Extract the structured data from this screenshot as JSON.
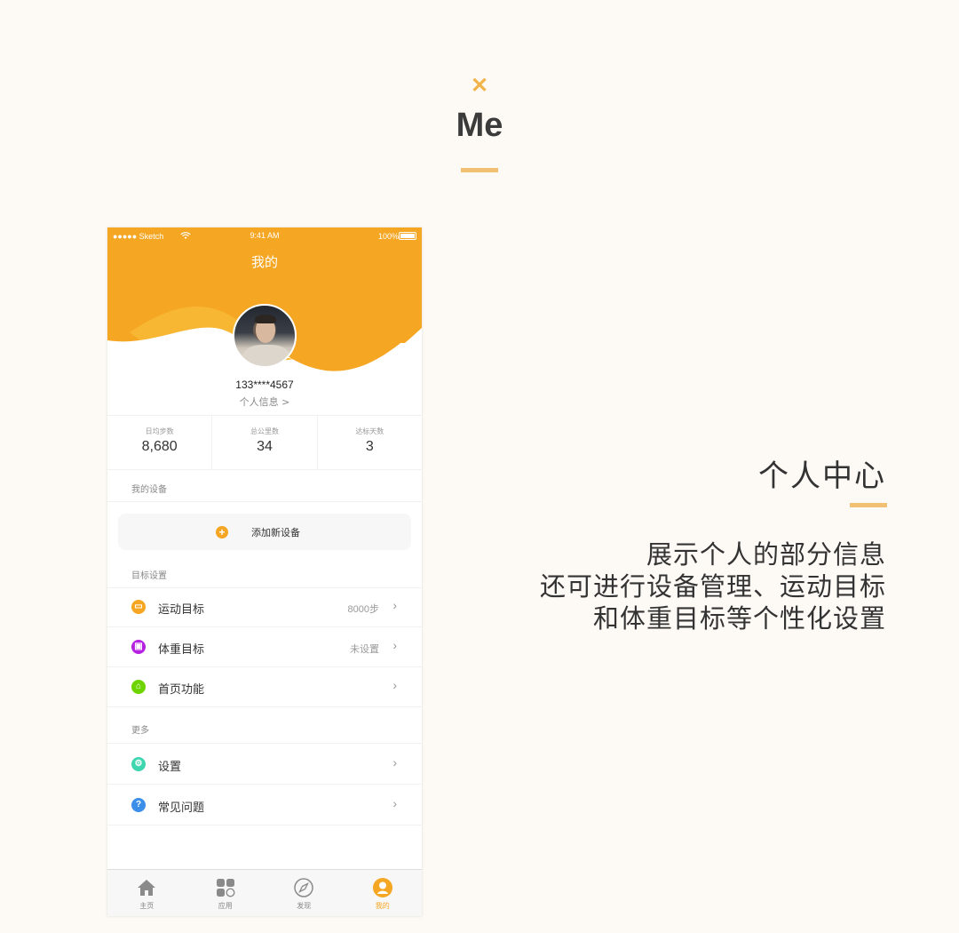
{
  "header": {
    "icon": "close-x-icon",
    "title": "Me"
  },
  "side": {
    "title": "个人中心",
    "desc": [
      "展示个人的部分信息",
      "还可进行设备管理、运动目标",
      "和体重目标等个性化设置"
    ]
  },
  "colors": {
    "accent": "#f5a623",
    "bar": "#f2c073",
    "background": "#fdfaf6"
  },
  "phone": {
    "status": {
      "carrier": "●●●●● Sketch",
      "time": "9:41 AM",
      "battery": "100%"
    },
    "nav_title": "我的",
    "profile": {
      "phone_number": "133****4567",
      "link": "个人信息 >"
    },
    "stats": [
      {
        "label": "日均步数",
        "value": "8,680"
      },
      {
        "label": "总公里数",
        "value": "34"
      },
      {
        "label": "达标天数",
        "value": "3"
      }
    ],
    "devices": {
      "section": "我的设备",
      "add_label": "添加新设备"
    },
    "goals": {
      "section": "目标设置",
      "items": [
        {
          "label": "运动目标",
          "value": "8000步",
          "icon": "sport-goal-icon",
          "color": "#f5a623"
        },
        {
          "label": "体重目标",
          "value": "未设置",
          "icon": "weight-goal-icon",
          "color": "#b620e0"
        },
        {
          "label": "首页功能",
          "value": "",
          "icon": "home-feature-icon",
          "color": "#6dd400"
        }
      ]
    },
    "more": {
      "section": "更多",
      "items": [
        {
          "label": "设置",
          "icon": "settings-icon",
          "color": "#3ed6b0"
        },
        {
          "label": "常见问题",
          "icon": "faq-icon",
          "color": "#3b8fe8"
        }
      ]
    },
    "tabs": [
      {
        "label": "主页",
        "icon": "home-icon"
      },
      {
        "label": "应用",
        "icon": "apps-icon"
      },
      {
        "label": "发现",
        "icon": "compass-icon"
      },
      {
        "label": "我的",
        "icon": "profile-icon",
        "active": true
      }
    ]
  }
}
